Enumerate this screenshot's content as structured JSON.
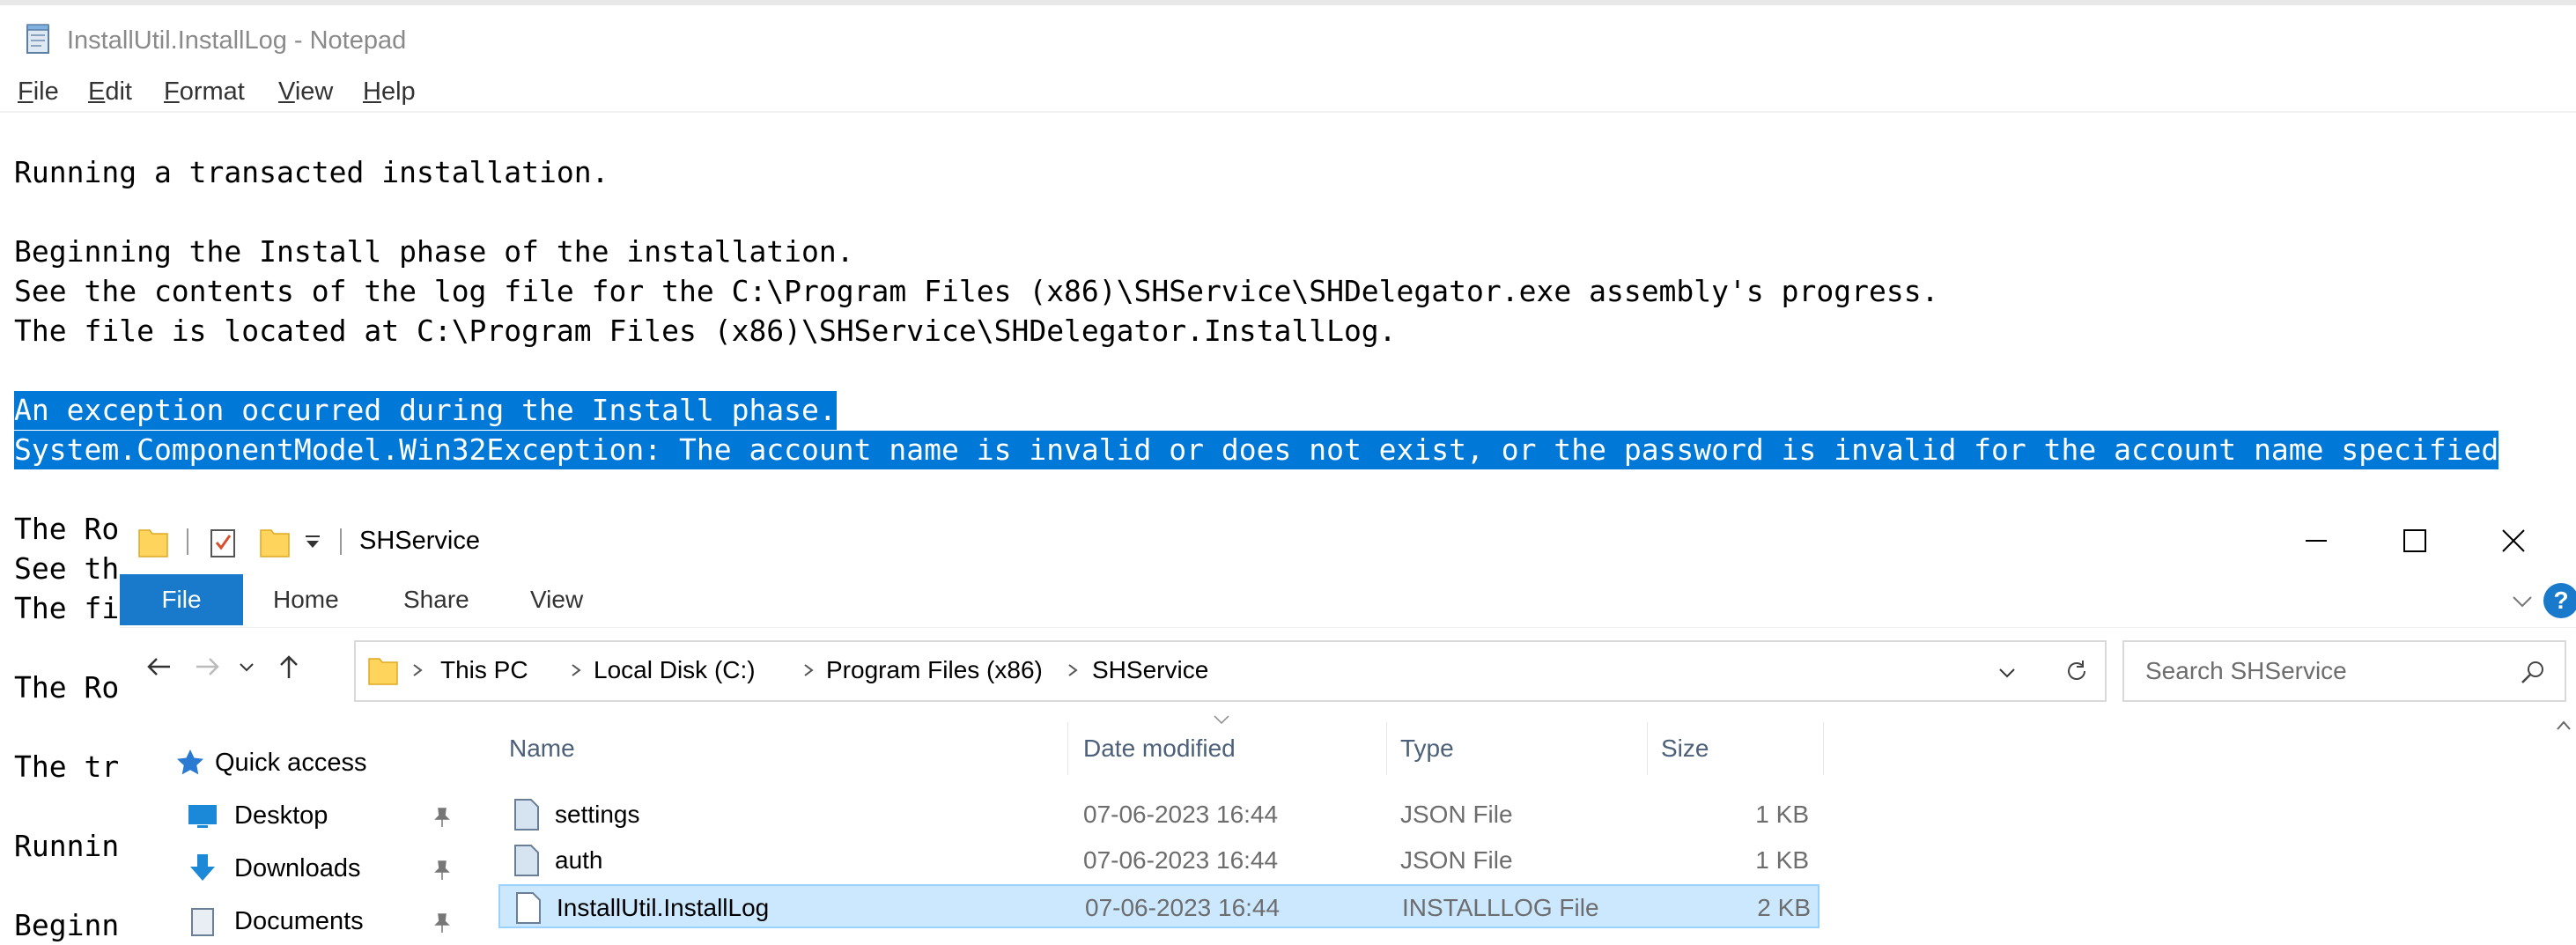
{
  "notepad": {
    "title": "InstallUtil.InstallLog - Notepad",
    "menu": [
      {
        "label": "File"
      },
      {
        "label": "Edit"
      },
      {
        "label": "Format"
      },
      {
        "label": "View"
      },
      {
        "label": "Help"
      }
    ],
    "lines": [
      "Running a transacted installation.",
      "",
      "Beginning the Install phase of the installation.",
      "See the contents of the log file for the C:\\Program Files (x86)\\SHService\\SHDelegator.exe assembly's progress.",
      "The file is located at C:\\Program Files (x86)\\SHService\\SHDelegator.InstallLog.",
      "",
      "An exception occurred during the Install phase.",
      "System.ComponentModel.Win32Exception: The account name is invalid or does not exist, or the password is invalid for the account name specified",
      "",
      "The Ro",
      "See th",
      "The fi",
      "",
      "The Ro",
      "",
      "The tr",
      "",
      "Runnin",
      "",
      "Beginn"
    ],
    "selected_lines": [
      6,
      7
    ]
  },
  "explorer": {
    "title": "SHService",
    "ribbon": {
      "file": "File",
      "tabs": [
        "Home",
        "Share",
        "View"
      ],
      "help": "?"
    },
    "breadcrumb": [
      "This PC",
      "Local Disk (C:)",
      "Program Files (x86)",
      "SHService"
    ],
    "search": {
      "placeholder": "Search SHService"
    },
    "nav_pane": [
      {
        "label": "Quick access",
        "icon": "star-icon",
        "pinned": false
      },
      {
        "label": "Desktop",
        "icon": "desktop-icon",
        "pinned": true
      },
      {
        "label": "Downloads",
        "icon": "download-icon",
        "pinned": true
      },
      {
        "label": "Documents",
        "icon": "documents-icon",
        "pinned": true
      }
    ],
    "columns": [
      "Name",
      "Date modified",
      "Type",
      "Size"
    ],
    "files": [
      {
        "name": "settings",
        "date": "07-06-2023 16:44",
        "type": "JSON File",
        "size": "1 KB",
        "selected": false
      },
      {
        "name": "auth",
        "date": "07-06-2023 16:44",
        "type": "JSON File",
        "size": "1 KB",
        "selected": false
      },
      {
        "name": "InstallUtil.InstallLog",
        "date": "07-06-2023 16:44",
        "type": "INSTALLLOG File",
        "size": "2 KB",
        "selected": true
      }
    ],
    "colors": {
      "accent": "#1979ca",
      "selection": "#cce8ff",
      "text_selection": "#0078d7"
    }
  }
}
